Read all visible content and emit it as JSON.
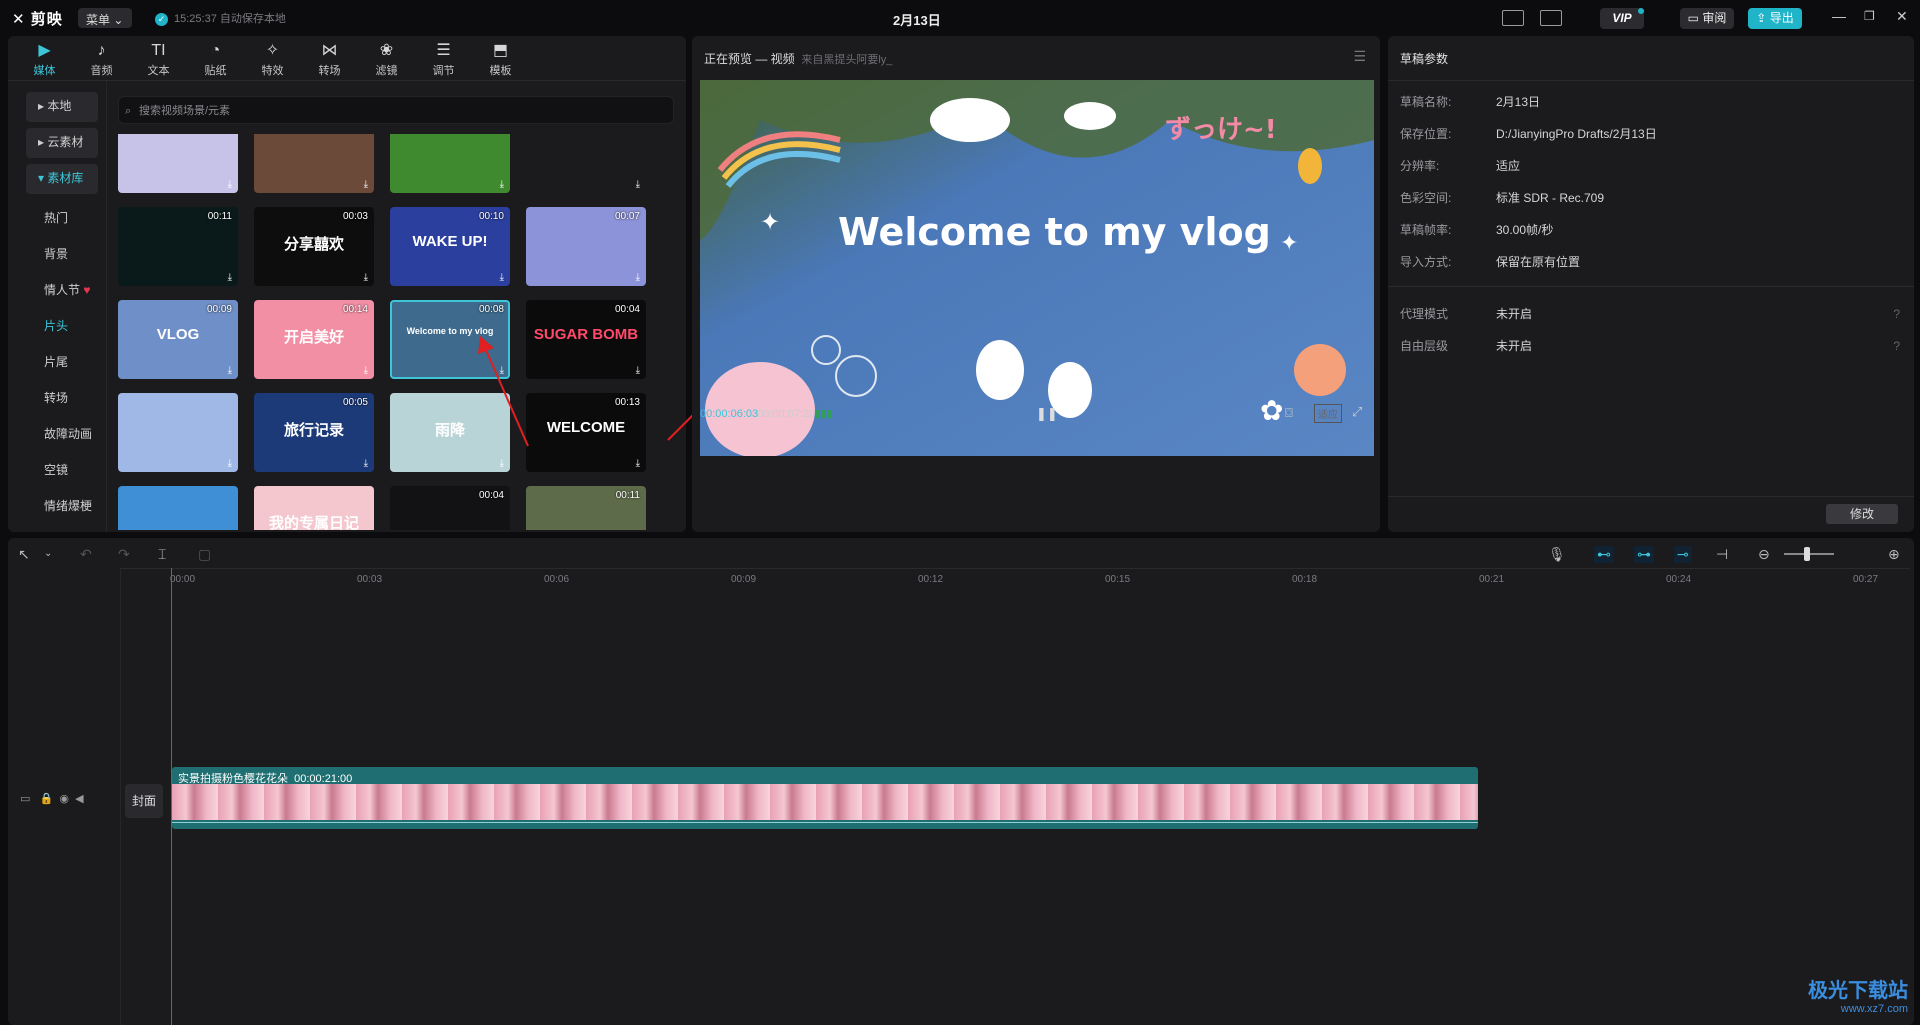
{
  "app": {
    "logo": "剪映",
    "menu_label": "菜单",
    "autosave_text": "15:25:37 自动保存本地",
    "title": "2月13日"
  },
  "topbar": {
    "vip_label": "VIP",
    "review_label": "审阅",
    "export_label": "导出"
  },
  "media_tabs": [
    {
      "label": "媒体",
      "icon": "media-icon",
      "glyph": "▶"
    },
    {
      "label": "音频",
      "icon": "audio-icon",
      "glyph": "♪"
    },
    {
      "label": "文本",
      "icon": "text-icon",
      "glyph": "TI"
    },
    {
      "label": "贴纸",
      "icon": "sticker-icon",
      "glyph": "◔"
    },
    {
      "label": "特效",
      "icon": "effects-icon",
      "glyph": "✧"
    },
    {
      "label": "转场",
      "icon": "transition-icon",
      "glyph": "⋈"
    },
    {
      "label": "滤镜",
      "icon": "filter-icon",
      "glyph": "❀"
    },
    {
      "label": "调节",
      "icon": "adjust-icon",
      "glyph": "☰"
    },
    {
      "label": "模板",
      "icon": "template-icon",
      "glyph": "⬒"
    }
  ],
  "sidebar": {
    "local": "本地",
    "cloud": "云素材",
    "library": "素材库",
    "subs": [
      "热门",
      "背景",
      "情人节",
      "片头",
      "片尾",
      "转场",
      "故障动画",
      "空镜",
      "情绪爆梗"
    ],
    "heart": "♥"
  },
  "search": {
    "placeholder": "搜索视频场景/元素"
  },
  "thumbs": [
    {
      "duration": "",
      "text": "",
      "bg": "#c7c3e8"
    },
    {
      "duration": "",
      "text": "",
      "bg": "#6b4a3a"
    },
    {
      "duration": "",
      "text": "",
      "bg": "#3f8a2f"
    },
    {
      "duration": "",
      "text": "",
      "bg": "#1b1b1e"
    },
    {
      "duration": "00:11",
      "text": "",
      "bg": "#0a1a1a"
    },
    {
      "duration": "00:03",
      "text": "分享囍欢",
      "bg": "#0d0d0d"
    },
    {
      "duration": "00:10",
      "text": "WAKE UP!",
      "bg": "#2b3f9e"
    },
    {
      "duration": "00:07",
      "text": "",
      "bg": "#8d93d8"
    },
    {
      "duration": "00:09",
      "text": "VLOG",
      "bg": "#6f8fc8"
    },
    {
      "duration": "00:14",
      "text": "开启美好",
      "bg": "#f28fa5"
    },
    {
      "duration": "00:08",
      "text": "Welcome to my vlog",
      "bg": "#3d6a8d"
    },
    {
      "duration": "00:04",
      "text": "SUGAR BOMB",
      "bg": "#0b0b0c"
    },
    {
      "duration": "",
      "text": "",
      "bg": "#9fb8e6"
    },
    {
      "duration": "00:05",
      "text": "旅行记录",
      "bg": "#1c3a78"
    },
    {
      "duration": "",
      "text": "雨降",
      "bg": "#b9d4d7"
    },
    {
      "duration": "00:13",
      "text": "WELCOME",
      "bg": "#0b0b0c"
    },
    {
      "duration": "",
      "text": "",
      "bg": "#3e8fd6"
    },
    {
      "duration": "",
      "text": "我的专属日记",
      "bg": "#f4c7cf"
    },
    {
      "duration": "00:04",
      "text": "",
      "bg": "#121214"
    },
    {
      "duration": "00:11",
      "text": "",
      "bg": "#5d6b4a"
    }
  ],
  "preview": {
    "header": "正在预览 — 视频",
    "source": "来自黑提头阿要ly_",
    "overlay_text": "Welcome to my vlog",
    "japanese_text": "ずっけ~!",
    "current_time": "00:00:06:03",
    "total_time": "00:00:07:20",
    "ratio_label": "适应"
  },
  "draft": {
    "title": "草稿参数",
    "rows": [
      {
        "k": "草稿名称:",
        "v": "2月13日"
      },
      {
        "k": "保存位置:",
        "v": "D:/JianyingPro Drafts/2月13日"
      },
      {
        "k": "分辨率:",
        "v": "适应"
      },
      {
        "k": "色彩空间:",
        "v": "标准 SDR - Rec.709"
      },
      {
        "k": "草稿帧率:",
        "v": "30.00帧/秒"
      },
      {
        "k": "导入方式:",
        "v": "保留在原有位置"
      }
    ],
    "rows2": [
      {
        "k": "代理模式",
        "v": "未开启"
      },
      {
        "k": "自由层级",
        "v": "未开启"
      }
    ],
    "modify_label": "修改"
  },
  "timeline": {
    "ruler": [
      "00:00",
      "00:03",
      "00:06",
      "00:09",
      "00:12",
      "00:15",
      "00:18",
      "00:21",
      "00:24",
      "00:27"
    ],
    "cover_label": "封面",
    "clip_name": "实景拍摄粉色樱花花朵",
    "clip_duration": "00:00:21:00"
  },
  "watermark": {
    "name": "极光下载站",
    "url": "www.xz7.com"
  },
  "colors": {
    "accent": "#3ec6d8",
    "clip": "#1f6f72",
    "export": "#1fb4c8"
  }
}
